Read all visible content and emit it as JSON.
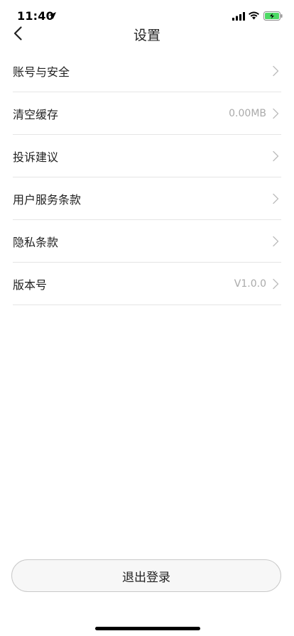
{
  "status_bar": {
    "time": "11:40",
    "icons": [
      "location-arrow-icon",
      "signal-icon",
      "wifi-icon",
      "battery-charging-icon"
    ],
    "battery_color": "#4cd964"
  },
  "nav": {
    "title": "设置",
    "back_icon": "chevron-left-icon"
  },
  "settings": {
    "items": [
      {
        "label": "账号与安全",
        "value": ""
      },
      {
        "label": "清空缓存",
        "value": "0.00MB"
      },
      {
        "label": "投诉建议",
        "value": ""
      },
      {
        "label": "用户服务条款",
        "value": ""
      },
      {
        "label": "隐私条款",
        "value": ""
      },
      {
        "label": "版本号",
        "value": "V1.0.0"
      }
    ]
  },
  "logout": {
    "label": "退出登录"
  },
  "colors": {
    "divider": "#e5e5e5",
    "secondary_text": "#aaaaaa",
    "button_border": "#c9c9c9"
  }
}
